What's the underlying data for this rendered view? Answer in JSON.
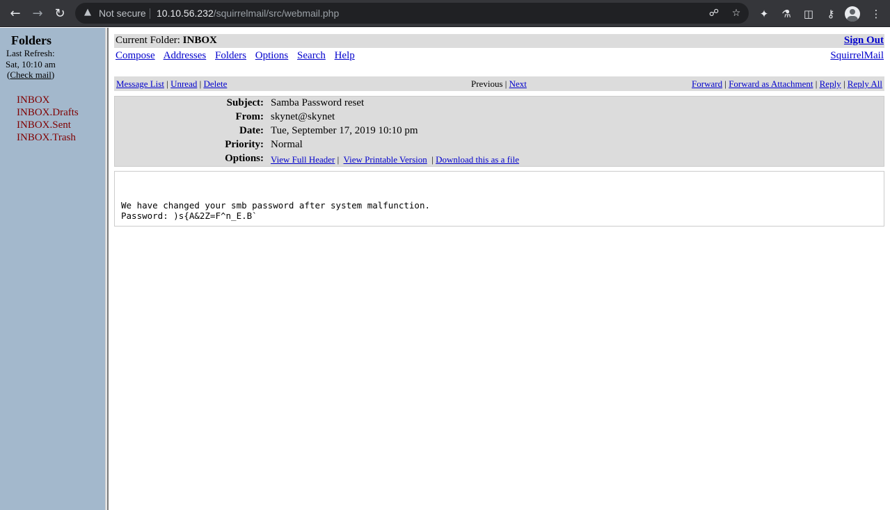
{
  "browser": {
    "security_label": "Not secure",
    "url_host": "10.10.56.232",
    "url_path": "/squirrelmail/src/webmail.php"
  },
  "left": {
    "title": "Folders",
    "last_refresh_label": "Last Refresh:",
    "last_refresh_time": "Sat, 10:10 am",
    "check_mail_open": "(",
    "check_mail_label": "Check mail",
    "check_mail_close": ")",
    "folders": [
      "INBOX",
      "INBOX.Drafts",
      "INBOX.Sent",
      "INBOX.Trash"
    ]
  },
  "top": {
    "current_folder_label": "Current Folder: ",
    "current_folder": "INBOX",
    "sign_out": "Sign Out",
    "menu": [
      "Compose",
      "Addresses",
      "Folders",
      "Options",
      "Search",
      "Help"
    ],
    "brand": "SquirrelMail"
  },
  "actions": {
    "message_list": "Message List",
    "unread": "Unread",
    "delete": "Delete",
    "previous": "Previous",
    "next": "Next",
    "forward": "Forward",
    "forward_attachment": "Forward as Attachment",
    "reply": "Reply",
    "reply_all": "Reply All",
    "separator": " | "
  },
  "message": {
    "subject_label": "Subject:",
    "subject": "Samba Password reset",
    "from_label": "From:",
    "from": "skynet@skynet",
    "date_label": "Date:",
    "date": "Tue, September 17, 2019 10:10 pm",
    "priority_label": "Priority:",
    "priority": "Normal",
    "options_label": "Options:",
    "view_full_header": "View Full Header",
    "view_printable": "View Printable Version",
    "download": "Download this as a file",
    "body": "We have changed your smb password after system malfunction.\nPassword: )s{A&2Z=F^n_E.B`"
  }
}
